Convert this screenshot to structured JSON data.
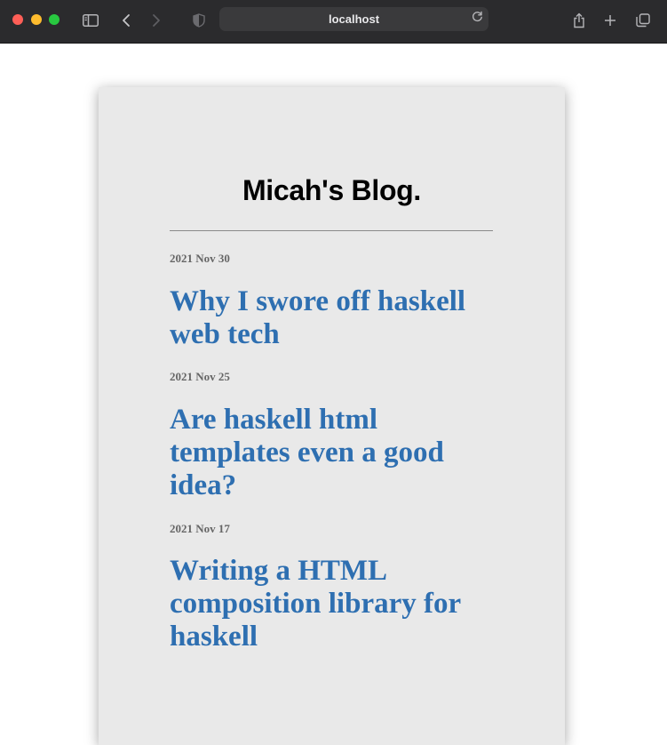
{
  "browser": {
    "url": "localhost",
    "icons": {
      "close": "close-dot",
      "minimize": "minimize-dot",
      "zoom": "zoom-dot",
      "sidebar": "sidebar-icon",
      "back": "back-icon",
      "forward": "forward-icon",
      "shield": "shield-icon",
      "reload": "reload-icon",
      "share": "share-icon",
      "new_tab": "plus-icon",
      "tabs": "tabs-overview-icon"
    },
    "colors": {
      "close": "#ff5f57",
      "minimize": "#febc2e",
      "zoom": "#28c840",
      "toolbar": "#2b2b2d"
    }
  },
  "blog": {
    "title": "Micah's Blog.",
    "accent": "#2e6fb1",
    "posts": [
      {
        "date": "2021 Nov 30",
        "title": "Why I swore off haskell web tech"
      },
      {
        "date": "2021 Nov 25",
        "title": "Are haskell html templates even a good idea?"
      },
      {
        "date": "2021 Nov 17",
        "title": "Writing a HTML composition library for haskell"
      }
    ]
  }
}
